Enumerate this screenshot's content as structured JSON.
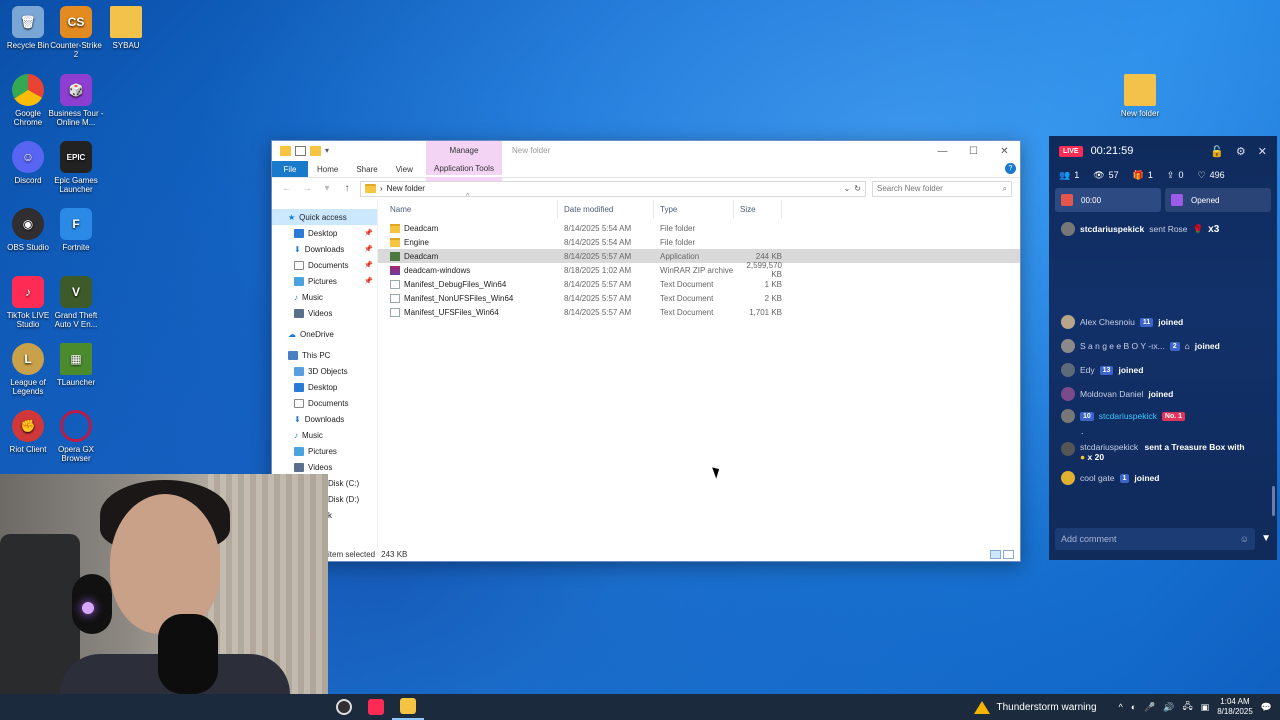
{
  "desktop": {
    "icons": [
      {
        "label": "Recycle Bin",
        "color": "#7aa6d6"
      },
      {
        "label": "Counter-Strike 2",
        "color": "#e38a20"
      },
      {
        "label": "SYBAU",
        "color": "#f2c24a"
      },
      {
        "label": "Google Chrome",
        "color": "#34a853"
      },
      {
        "label": "Business Tour - Online M...",
        "color": "#8e3fd1"
      },
      {
        "label": "Discord",
        "color": "#5865f2"
      },
      {
        "label": "Epic Games Launcher",
        "color": "#222222"
      },
      {
        "label": "OBS Studio",
        "color": "#302e31"
      },
      {
        "label": "Fortnite",
        "color": "#2b8ae6"
      },
      {
        "label": "TikTok LIVE Studio",
        "color": "#fe2c55"
      },
      {
        "label": "Grand Theft Auto V En...",
        "color": "#3d5a2a"
      },
      {
        "label": "League of Legends",
        "color": "#c8a14a"
      },
      {
        "label": "TLauncher",
        "color": "#4c8a2e"
      },
      {
        "label": "Riot Client",
        "color": "#d13639"
      },
      {
        "label": "Opera GX Browser",
        "color": "#b71c4a"
      },
      {
        "label": "New folder",
        "color": "#f2c24a"
      }
    ]
  },
  "explorer": {
    "manage_tab": "Manage",
    "title": "New folder",
    "ribbon": {
      "file": "File",
      "home": "Home",
      "share": "Share",
      "view": "View",
      "app_tools": "Application Tools"
    },
    "address": "New folder",
    "search_placeholder": "Search New folder",
    "nav": {
      "quick_access": "Quick access",
      "desktop": "Desktop",
      "downloads": "Downloads",
      "documents": "Documents",
      "pictures": "Pictures",
      "music": "Music",
      "videos": "Videos",
      "onedrive": "OneDrive",
      "this_pc": "This PC",
      "objects3d": "3D Objects",
      "pc_desktop": "Desktop",
      "pc_documents": "Documents",
      "pc_downloads": "Downloads",
      "pc_music": "Music",
      "pc_pictures": "Pictures",
      "pc_videos": "Videos",
      "disk_c": "Disk (C:)",
      "disk_d": "Disk (D:)",
      "network": "k"
    },
    "columns": {
      "name": "Name",
      "date": "Date modified",
      "type": "Type",
      "size": "Size"
    },
    "files": [
      {
        "name": "Deadcam",
        "date": "8/14/2025 5:54 AM",
        "type": "File folder",
        "size": ""
      },
      {
        "name": "Engine",
        "date": "8/14/2025 5:54 AM",
        "type": "File folder",
        "size": ""
      },
      {
        "name": "Deadcam",
        "date": "8/14/2025 5:57 AM",
        "type": "Application",
        "size": "244 KB"
      },
      {
        "name": "deadcam-windows",
        "date": "8/18/2025 1:02 AM",
        "type": "WinRAR ZIP archive",
        "size": "2,599,570 KB"
      },
      {
        "name": "Manifest_DebugFiles_Win64",
        "date": "8/14/2025 5:57 AM",
        "type": "Text Document",
        "size": "1 KB"
      },
      {
        "name": "Manifest_NonUFSFiles_Win64",
        "date": "8/14/2025 5:57 AM",
        "type": "Text Document",
        "size": "2 KB"
      },
      {
        "name": "Manifest_UFSFiles_Win64",
        "date": "8/14/2025 5:57 AM",
        "type": "Text Document",
        "size": "1,701 KB"
      }
    ],
    "status_selected": "item selected",
    "status_size": "243 KB"
  },
  "live": {
    "badge": "LIVE",
    "timer": "00:21:59",
    "stats": {
      "users": "1",
      "views": "57",
      "gifts": "1",
      "shares": "0",
      "likes": "496"
    },
    "card1": "00:00",
    "card2": "Opened",
    "gift": {
      "user": "stcdariuspekick",
      "text": "sent Rose",
      "count": "x3"
    },
    "feed": [
      {
        "user": "Alex Chesnoiu",
        "level": "11",
        "action": "joined"
      },
      {
        "user": "S a n g e e  B O Y  -ıx...",
        "level": "2",
        "action": "joined"
      },
      {
        "user": "Edy",
        "level": "13",
        "action": "joined"
      },
      {
        "user": "Moldovan Daniel",
        "level": "",
        "action": "joined"
      }
    ],
    "msg": {
      "level": "10",
      "user": "stcdariuspekick",
      "badge": "No. 1",
      "text": "."
    },
    "treasure": {
      "user": "stcdariuspekick",
      "text": "sent a Treasure Box with",
      "count": "x 20"
    },
    "last": {
      "user": "cool gate",
      "level": "1",
      "action": "joined"
    },
    "comment_placeholder": "Add comment"
  },
  "taskbar": {
    "warning": "Thunderstorm warning",
    "time": "1:04 AM",
    "date": "8/18/2025"
  }
}
